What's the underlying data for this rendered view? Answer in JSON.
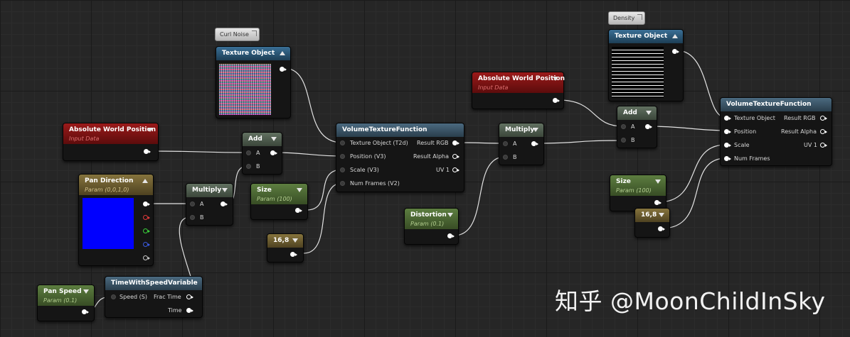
{
  "comments": {
    "curl_noise": "Curl Noise",
    "density": "Density"
  },
  "nodes": {
    "texture_object_1": {
      "title": "Texture Object"
    },
    "texture_object_2": {
      "title": "Texture Object"
    },
    "abs_world_pos_1": {
      "title": "Absolute World Position",
      "subtitle": "Input Data"
    },
    "abs_world_pos_2": {
      "title": "Absolute World Position",
      "subtitle": "Input Data"
    },
    "add_1": {
      "title": "Add",
      "in_a": "A",
      "in_b": "B"
    },
    "add_2": {
      "title": "Add",
      "in_a": "A",
      "in_b": "B"
    },
    "pan_direction": {
      "title": "Pan Direction",
      "subtitle": "Param (0,0,1,0)",
      "color": "#0000ff"
    },
    "multiply_1": {
      "title": "Multiply",
      "in_a": "A",
      "in_b": "B"
    },
    "multiply_2": {
      "title": "Multiply",
      "in_a": "A",
      "in_b": "B"
    },
    "time_with_speed": {
      "title": "TimeWithSpeedVariable",
      "in_speed": "Speed (S)",
      "out_frac": "Frac Time",
      "out_time": "Time"
    },
    "pan_speed": {
      "title": "Pan Speed",
      "subtitle": "Param (0.1)"
    },
    "size_1": {
      "title": "Size",
      "subtitle": "Param (100)"
    },
    "size_2": {
      "title": "Size",
      "subtitle": "Param (100)"
    },
    "const_1": {
      "title": "16,8"
    },
    "const_2": {
      "title": "16,8"
    },
    "distortion": {
      "title": "Distortion",
      "subtitle": "Param (0.1)"
    },
    "vtf_1": {
      "title": "VolumeTextureFunction",
      "inputs": [
        "Texture Object (T2d)",
        "Position (V3)",
        "Scale (V3)",
        "Num Frames (V2)"
      ],
      "outputs": [
        "Result RGB",
        "Result Alpha",
        "UV 1"
      ]
    },
    "vtf_2": {
      "title": "VolumeTextureFunction",
      "inputs": [
        "Texture Object",
        "Position",
        "Scale",
        "Num Frames"
      ],
      "outputs": [
        "Result RGB",
        "Result Alpha",
        "UV 1"
      ]
    }
  },
  "watermark": "知乎 @MoonChildInSky",
  "colors": {
    "wire": "#e0e0e0",
    "header_blue": "#2f5a7a",
    "header_red": "#7a1414",
    "header_green": "#4b6a33",
    "header_gold": "#6b5d30",
    "pan_color_swatch": "#0000ff"
  }
}
